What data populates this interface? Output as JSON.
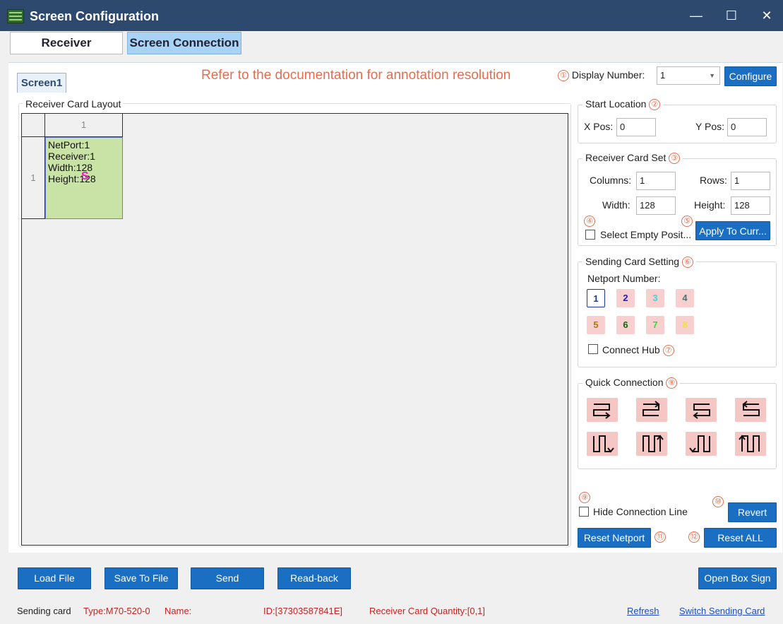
{
  "window": {
    "title": "Screen Configuration",
    "controls": {
      "minimize": "—",
      "maximize": "☐",
      "close": "✕"
    }
  },
  "tabs": [
    {
      "label": "Receiver",
      "active": false
    },
    {
      "label": "Screen Connection",
      "active": true
    }
  ],
  "screen_tab": "Screen1",
  "annotation_note": "Refer to the documentation for annotation resolution",
  "display": {
    "marker": "①",
    "label": "Display Number:",
    "value": "1",
    "configure_label": "Configure"
  },
  "layout": {
    "title": "Receiver Card Layout",
    "column_header": "1",
    "row_header": "1",
    "cell": {
      "netport": "NetPort:1",
      "receiver": "Receiver:1",
      "width": "Width:128",
      "height": "Height:128",
      "marker": "S"
    }
  },
  "start_location": {
    "title": "Start Location",
    "marker": "②",
    "x_label": "X Pos:",
    "x_value": "0",
    "y_label": "Y Pos:",
    "y_value": "0"
  },
  "receiver_card_set": {
    "title": "Receiver Card Set",
    "marker": "③",
    "columns_label": "Columns:",
    "columns_value": "1",
    "rows_label": "Rows:",
    "rows_value": "1",
    "width_label": "Width:",
    "width_value": "128",
    "height_label": "Height:",
    "height_value": "128",
    "select_empty_marker": "④",
    "select_empty_label": "Select Empty Posit...",
    "apply_marker": "⑤",
    "apply_label": "Apply To Curr..."
  },
  "sending_card": {
    "title": "Sending Card Setting",
    "marker": "⑥",
    "netport_label": "Netport Number:",
    "netports": [
      {
        "label": "1",
        "color": "#1a3a8a",
        "selected": true
      },
      {
        "label": "2",
        "color": "#1a1ad6"
      },
      {
        "label": "3",
        "color": "#3fd6d6"
      },
      {
        "label": "4",
        "color": "#3a7a7a"
      },
      {
        "label": "5",
        "color": "#b07a00"
      },
      {
        "label": "6",
        "color": "#0a6a0a"
      },
      {
        "label": "7",
        "color": "#3fd63f"
      },
      {
        "label": "8",
        "color": "#f0e040"
      }
    ],
    "connect_hub_label": "Connect Hub",
    "connect_hub_marker": "⑦"
  },
  "quick_connection": {
    "title": "Quick Connection",
    "marker": "⑧",
    "icons": [
      "snake-right-down-icon",
      "snake-right-down-alt-icon",
      "snake-left-down-icon",
      "snake-left-down-alt-icon",
      "snake-down-right-icon",
      "snake-up-right-icon",
      "snake-down-left-icon",
      "snake-up-left-icon"
    ]
  },
  "hide_line": {
    "marker": "⑨",
    "label": "Hide Connection Line"
  },
  "revert": {
    "marker": "⑩",
    "label": "Revert"
  },
  "reset_netport": {
    "label": "Reset Netport",
    "marker": "⑪"
  },
  "reset_all": {
    "marker": "⑫",
    "label": "Reset ALL"
  },
  "bottom_buttons": {
    "load": "Load File",
    "save": "Save To File",
    "send": "Send",
    "readback": "Read-back",
    "open_box": "Open Box Sign"
  },
  "status": {
    "sending_card": "Sending card",
    "type": "Type:M70-520-0",
    "name": "Name:",
    "id": "ID:[37303587841E]",
    "quantity": "Receiver Card Quantity:[0,1]",
    "refresh": "Refresh",
    "switch": "Switch Sending Card"
  },
  "colors": {
    "accent": "#1a6fc2",
    "annotation": "#e86c4e",
    "cell": "#c9e2a6",
    "title_bar": "#2d4a6e"
  }
}
